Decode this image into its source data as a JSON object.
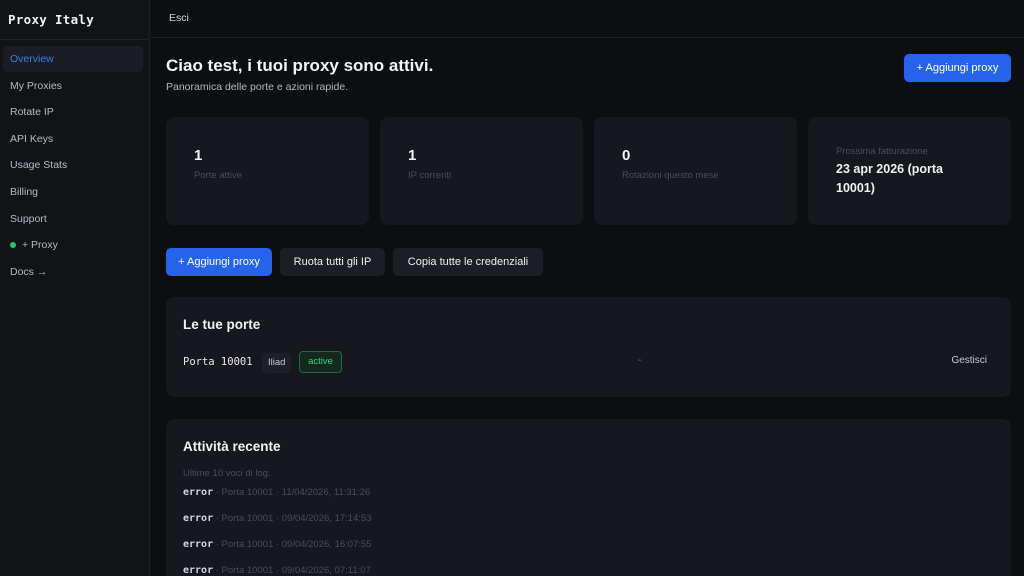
{
  "app": {
    "brand": "Proxy Italy"
  },
  "sidebar": {
    "items": [
      {
        "label": "Overview"
      },
      {
        "label": "My Proxies"
      },
      {
        "label": "Rotate IP"
      },
      {
        "label": "API Keys"
      },
      {
        "label": "Usage Stats"
      },
      {
        "label": "Billing"
      },
      {
        "label": "Support"
      },
      {
        "label": "+ Proxy"
      },
      {
        "label": "Docs →"
      }
    ],
    "active_index": 0
  },
  "topbar": {
    "logout_label": "Esci"
  },
  "header": {
    "title": "Ciao test, i tuoi proxy sono attivi.",
    "subtitle": "Panoramica delle porte e azioni rapide.",
    "add_button_label": "+ Aggiungi proxy"
  },
  "stats": [
    {
      "value": "1",
      "label": "Porte attive"
    },
    {
      "value": "1",
      "label": "IP correnti"
    },
    {
      "value": "0",
      "label": "Rotazioni questo mese"
    }
  ],
  "billing": {
    "label": "Prossima fatturazione",
    "value": "23 apr 2026 (porta 10001)"
  },
  "actions": {
    "add_label": "+ Aggiungi proxy",
    "rotate_label": "Ruota tutti gli IP",
    "copy_label": "Copia tutte le credenziali"
  },
  "ports_panel": {
    "title": "Le tue porte",
    "port": {
      "name": "Porta 10001",
      "carrier": "Iliad",
      "status": "active",
      "extra": "-",
      "manage_label": "Gestisci"
    }
  },
  "activity_panel": {
    "title": "Attività recente",
    "caption": "Ultime 10 voci di log.",
    "logs": [
      {
        "level": "error",
        "text": " · Porta 10001 · 11/04/2026, 11:31:26"
      },
      {
        "level": "error",
        "text": " · Porta 10001 · 09/04/2026, 17:14:53"
      },
      {
        "level": "error",
        "text": " · Porta 10001 · 09/04/2026, 16:07:55"
      },
      {
        "level": "error",
        "text": " · Porta 10001 · 09/04/2026, 07:11:07"
      }
    ]
  },
  "colors": {
    "accent": "#2563eb",
    "active_nav": "#3d7bf2",
    "status_green": "#34d17e",
    "dot": "#22c55e"
  }
}
